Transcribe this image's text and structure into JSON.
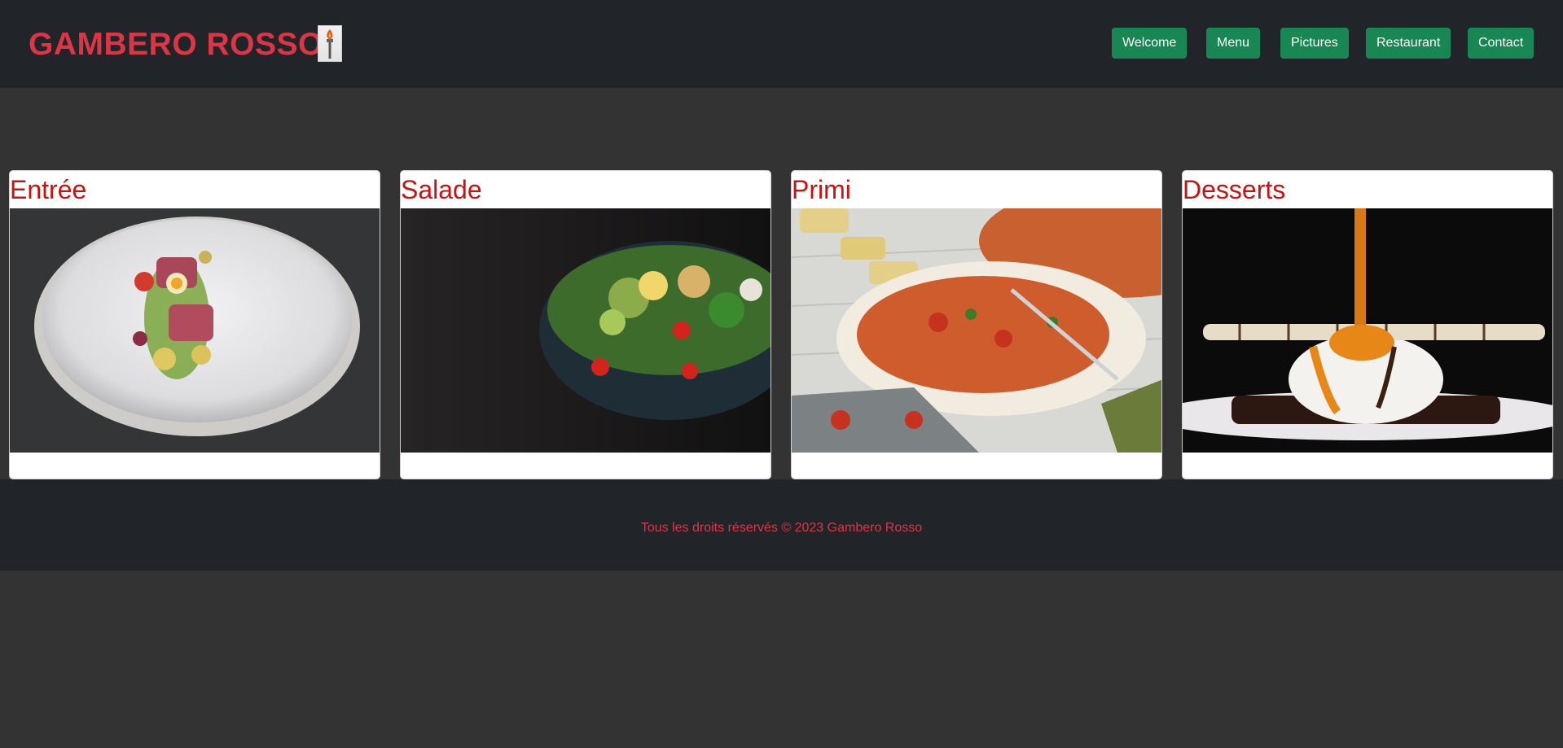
{
  "header": {
    "brand": "GAMBERO ROSSO",
    "logo_icon": "torch-logo-icon",
    "nav": [
      {
        "label": "Welcome"
      },
      {
        "label": "Menu"
      },
      {
        "label": "Pictures"
      },
      {
        "label": "Restaurant"
      },
      {
        "label": "Contact"
      }
    ]
  },
  "cards": [
    {
      "title": "Entrée",
      "photo": "plated-meat-vegetables-photo"
    },
    {
      "title": "Salade",
      "photo": "salad-bowl-photo"
    },
    {
      "title": "Primi",
      "photo": "fusilli-pasta-photo"
    },
    {
      "title": "Desserts",
      "photo": "ice-cream-caramel-dessert-photo"
    }
  ],
  "footer": {
    "text": "Tous les droits réservés © 2023 Gambero Rosso"
  },
  "colors": {
    "brand_red": "#dc3545",
    "card_title_red": "#cc1111",
    "nav_green": "#198754",
    "header_bg": "#212529",
    "page_bg": "#333333"
  }
}
